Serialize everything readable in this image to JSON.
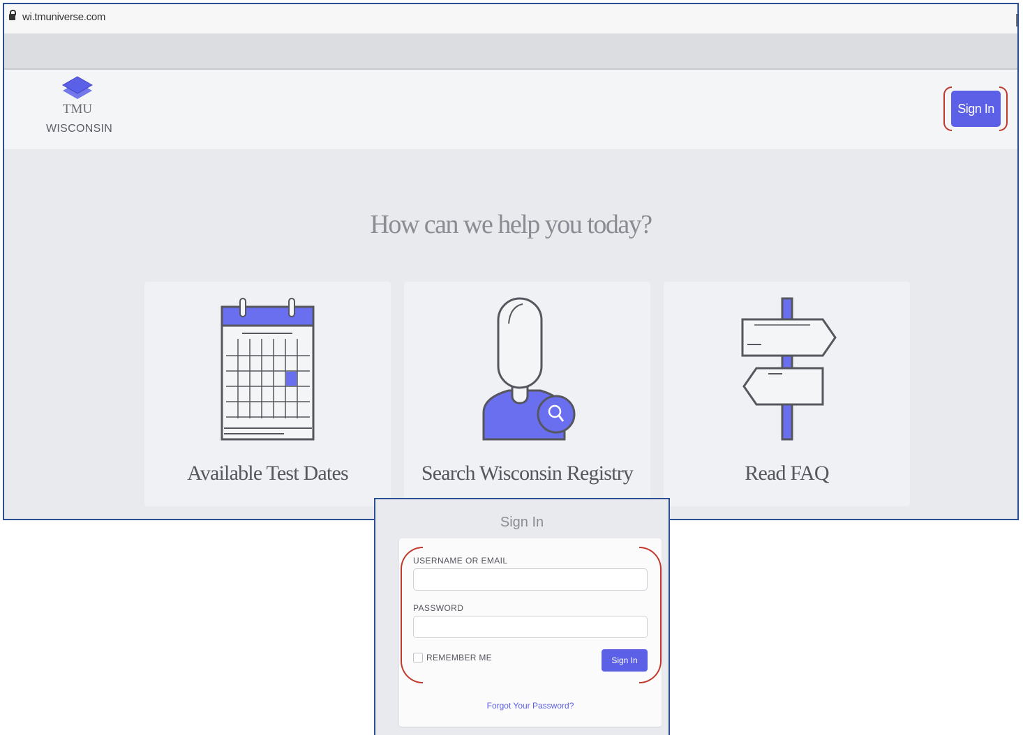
{
  "browser": {
    "url": "wi.tmuniverse.com"
  },
  "header": {
    "logo_line1": "TMU",
    "logo_line2": "WISCONSIN",
    "signin_label": "Sign In"
  },
  "main": {
    "heading": "How can we help you today?",
    "cards": [
      {
        "label": "Available Test Dates",
        "icon": "calendar-icon"
      },
      {
        "label": "Search Wisconsin Registry",
        "icon": "person-search-icon"
      },
      {
        "label": "Read FAQ",
        "icon": "signpost-icon"
      }
    ]
  },
  "signin_panel": {
    "title": "Sign In",
    "username_label": "USERNAME OR EMAIL",
    "username_value": "",
    "password_label": "PASSWORD",
    "password_value": "",
    "remember_label": "REMEMBER ME",
    "remember_checked": false,
    "submit_label": "Sign In",
    "forgot_link": "Forgot Your Password?"
  },
  "colors": {
    "accent": "#5b60e6",
    "highlight_annotation": "#c0392b",
    "frame_border": "#2c4f93"
  }
}
